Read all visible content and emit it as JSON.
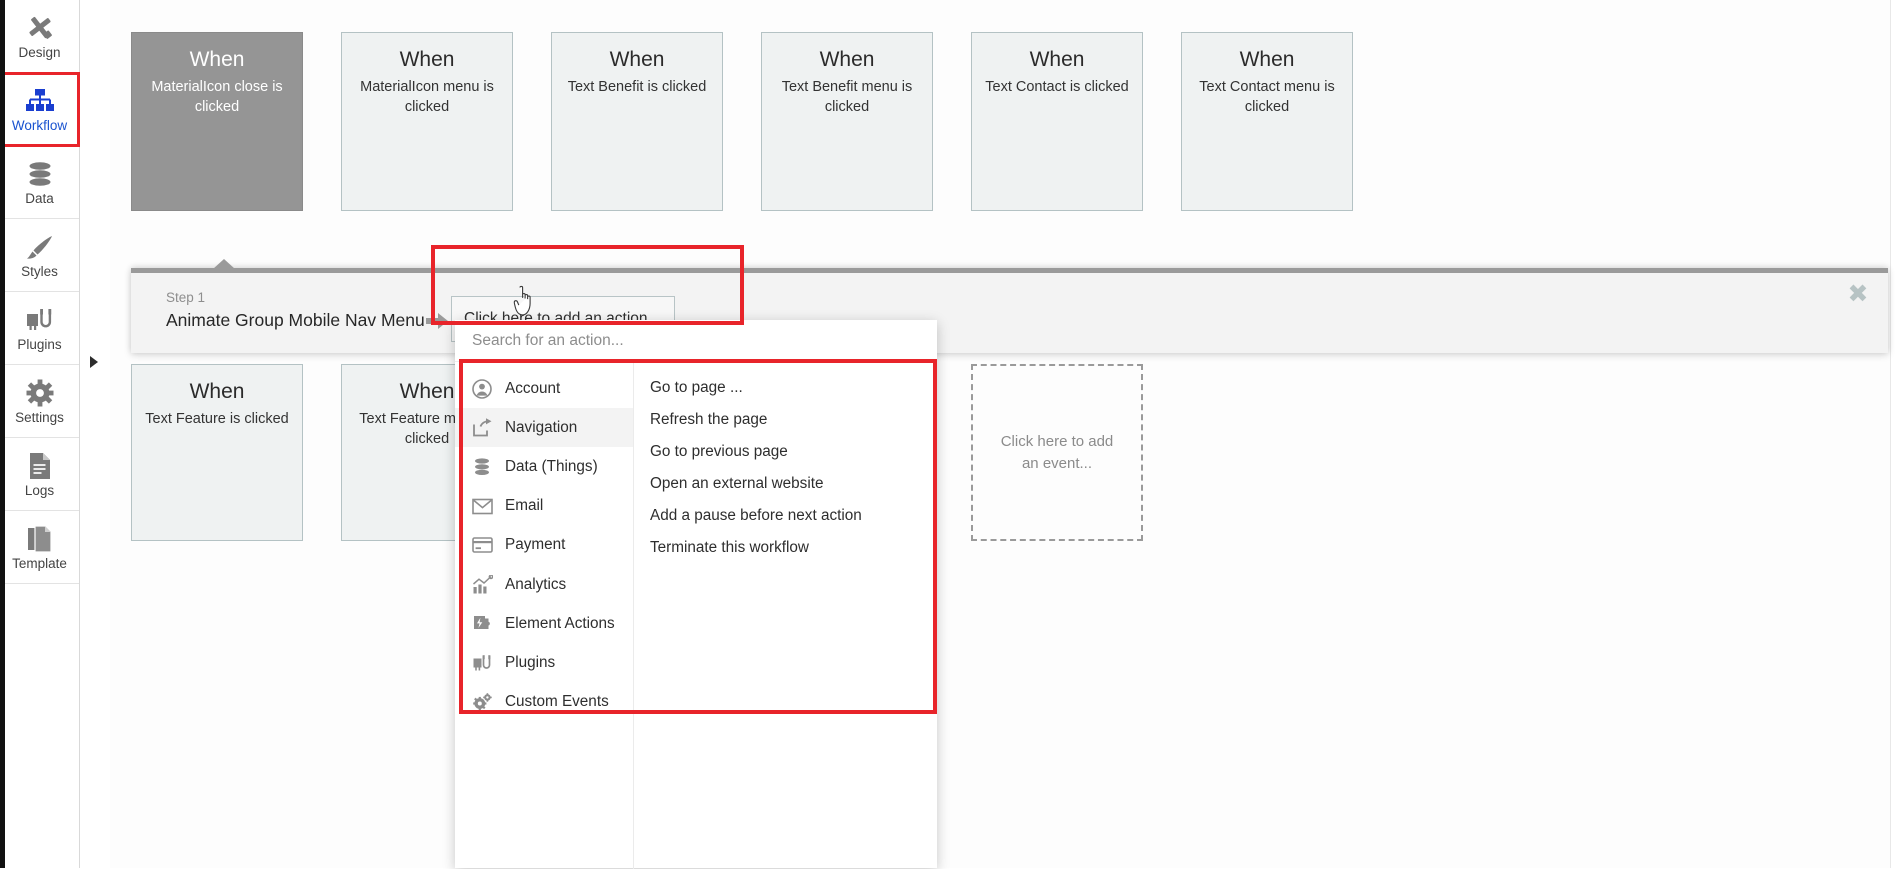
{
  "sidebar": {
    "items": [
      {
        "label": "Design",
        "icon": "design-icon",
        "active": false,
        "highlighted": false
      },
      {
        "label": "Workflow",
        "icon": "workflow-icon",
        "active": true,
        "highlighted": true
      },
      {
        "label": "Data",
        "icon": "data-icon",
        "active": false,
        "highlighted": false
      },
      {
        "label": "Styles",
        "icon": "styles-icon",
        "active": false,
        "highlighted": false
      },
      {
        "label": "Plugins",
        "icon": "plugins-icon",
        "active": false,
        "highlighted": false
      },
      {
        "label": "Settings",
        "icon": "settings-icon",
        "active": false,
        "highlighted": false
      },
      {
        "label": "Logs",
        "icon": "logs-icon",
        "active": false,
        "highlighted": false
      },
      {
        "label": "Template",
        "icon": "template-icon",
        "active": false,
        "highlighted": false
      }
    ],
    "collapse_icon": "chevron-right-icon"
  },
  "events_row1": [
    {
      "when": "When",
      "desc": "MaterialIcon close is clicked",
      "selected": true
    },
    {
      "when": "When",
      "desc": "MaterialIcon menu is clicked",
      "selected": false
    },
    {
      "when": "When",
      "desc": "Text Benefit is clicked",
      "selected": false
    },
    {
      "when": "When",
      "desc": "Text Benefit menu is clicked",
      "selected": false
    },
    {
      "when": "When",
      "desc": "Text Contact is clicked",
      "selected": false
    },
    {
      "when": "When",
      "desc": "Text Contact menu is clicked",
      "selected": false
    }
  ],
  "events_row2": [
    {
      "when": "When",
      "desc": "Text Feature is clicked",
      "selected": false
    },
    {
      "when": "When",
      "desc": "Text Feature menu is clicked",
      "selected": false
    }
  ],
  "add_event_placeholder": "Click here to add an event...",
  "step_panel": {
    "step_label": "Step 1",
    "step_title": "Animate Group Mobile Nav Menu",
    "arrow_icon": "arrow-right-icon",
    "add_action_label": "Click here to add an action...",
    "close_icon": "close-icon",
    "close_glyph": "✖"
  },
  "dropdown": {
    "search_placeholder": "Search for an action...",
    "categories": [
      {
        "label": "Account",
        "icon": "account-icon",
        "active": false
      },
      {
        "label": "Navigation",
        "icon": "navigation-icon",
        "active": true
      },
      {
        "label": "Data (Things)",
        "icon": "database-icon",
        "active": false
      },
      {
        "label": "Email",
        "icon": "envelope-icon",
        "active": false
      },
      {
        "label": "Payment",
        "icon": "credit-card-icon",
        "active": false
      },
      {
        "label": "Analytics",
        "icon": "analytics-icon",
        "active": false
      },
      {
        "label": "Element Actions",
        "icon": "element-actions-icon",
        "active": false
      },
      {
        "label": "Plugins",
        "icon": "plugins-icon",
        "active": false
      },
      {
        "label": "Custom Events",
        "icon": "custom-events-icon",
        "active": false
      }
    ],
    "actions": [
      "Go to page ...",
      "Refresh the page",
      "Go to previous page",
      "Open an external website",
      "Add a pause before next action",
      "Terminate this workflow"
    ]
  },
  "colors": {
    "highlight_red": "#e8242a",
    "accent_blue": "#1a53d0",
    "card_bg": "#eff2f2",
    "card_border": "#b4c2c4",
    "selected_card_bg": "#959595",
    "panel_bg": "#f3f3f3",
    "panel_bar": "#9a9a9a"
  }
}
